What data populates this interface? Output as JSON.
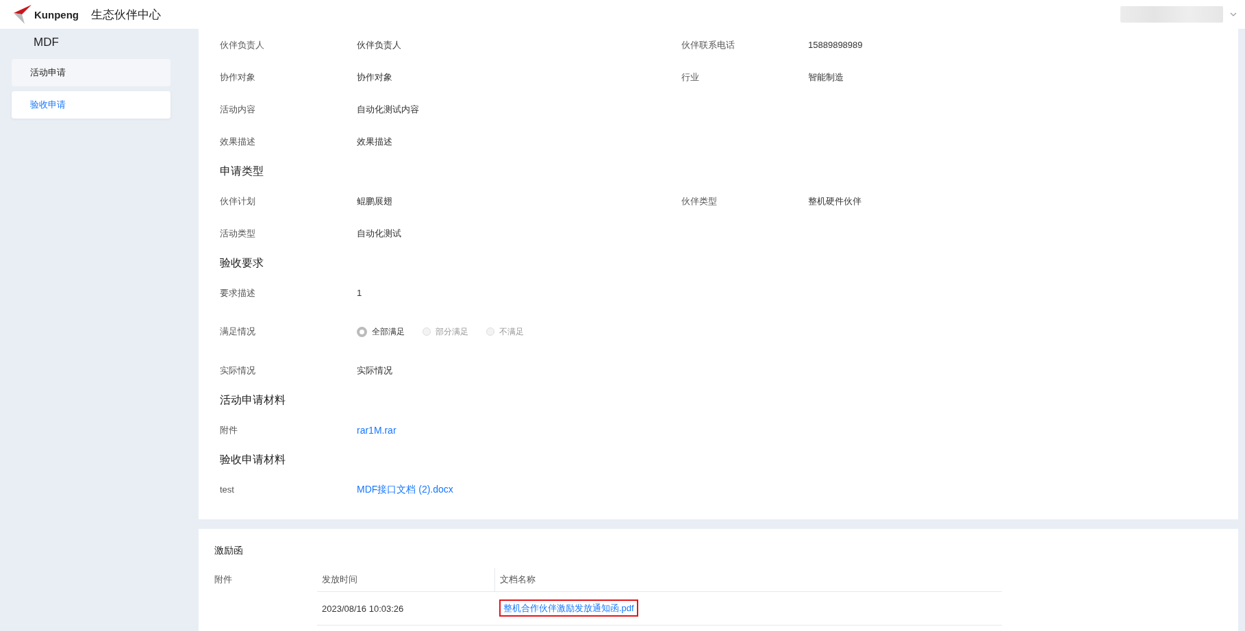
{
  "header": {
    "brand": "Kunpeng",
    "title": "生态伙伴中心"
  },
  "sidebar": {
    "title": "MDF",
    "items": [
      {
        "label": "活动申请",
        "selected": false
      },
      {
        "label": "验收申请",
        "selected": true
      }
    ]
  },
  "sections": [
    {
      "rows": [
        [
          {
            "label": "伙伴负责人",
            "kind": "text",
            "value": "伙伴负责人"
          },
          {
            "label": "伙伴联系电话",
            "kind": "text",
            "value": "15889898989"
          }
        ],
        [
          {
            "label": "协作对象",
            "kind": "text",
            "value": "协作对象"
          },
          {
            "label": "行业",
            "kind": "text",
            "value": "智能制造"
          }
        ],
        [
          {
            "label": "活动内容",
            "kind": "text",
            "value": "自动化测试内容"
          }
        ],
        [
          {
            "label": "效果描述",
            "kind": "text",
            "value": "效果描述"
          }
        ]
      ]
    },
    {
      "heading": "申请类型",
      "rows": [
        [
          {
            "label": "伙伴计划",
            "kind": "text",
            "value": "鲲鹏展翅"
          },
          {
            "label": "伙伴类型",
            "kind": "text",
            "value": "整机硬件伙伴"
          }
        ],
        [
          {
            "label": "活动类型",
            "kind": "text",
            "value": "自动化测试"
          }
        ]
      ]
    },
    {
      "heading": "验收要求",
      "rows": [
        [
          {
            "label": "要求描述",
            "kind": "text",
            "value": "1"
          }
        ],
        [
          {
            "label": "满足情况",
            "kind": "radio",
            "options": [
              {
                "label": "全部满足",
                "selected": true,
                "disabled": false
              },
              {
                "label": "部分满足",
                "selected": false,
                "disabled": true
              },
              {
                "label": "不满足",
                "selected": false,
                "disabled": true
              }
            ]
          }
        ],
        [
          {
            "label": "实际情况",
            "kind": "text",
            "value": "实际情况"
          }
        ]
      ]
    },
    {
      "heading": "活动申请材料",
      "rows": [
        [
          {
            "label": "附件",
            "kind": "link",
            "value": "rar1M.rar"
          }
        ]
      ]
    },
    {
      "heading": "验收申请材料",
      "rows": [
        [
          {
            "label": "test",
            "kind": "link",
            "value": "MDF接口文档 (2).docx"
          }
        ]
      ]
    }
  ],
  "incentive_letter": {
    "heading": "激励函",
    "label": "附件",
    "table": {
      "columns": [
        "发放时间",
        "文档名称"
      ],
      "rows": [
        {
          "time": "2023/08/16 10:03:26",
          "document": "整机合作伙伴激励发放通知函.pdf",
          "highlighted": true
        }
      ]
    }
  }
}
